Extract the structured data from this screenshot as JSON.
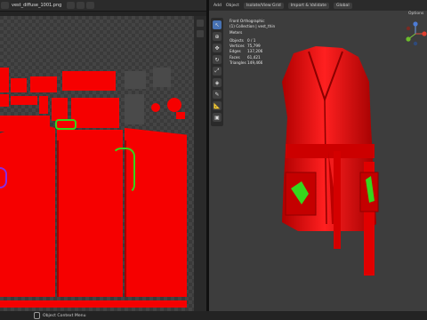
{
  "image_editor": {
    "filename": "vest_diffuse_1001.png"
  },
  "viewport": {
    "menu": [
      "Add",
      "Object"
    ],
    "chips": [
      "Isolate/View Grid",
      "Import & Validate",
      "Global"
    ],
    "options_label": "Options",
    "overlay": {
      "view": "Front Orthographic",
      "collection": "(1) Collection | vest_thin",
      "units": "Meters",
      "stats": [
        {
          "label": "Objects",
          "value": "0 / 1"
        },
        {
          "label": "Vertices",
          "value": "75,799"
        },
        {
          "label": "Edges",
          "value": "137,206"
        },
        {
          "label": "Faces",
          "value": "61,421"
        },
        {
          "label": "Triangles",
          "value": "149,466"
        }
      ]
    }
  },
  "status_bar": {
    "text": "Object Context Menu"
  },
  "colors": {
    "accent": "#f60000",
    "vest_base": "#e00606",
    "uv_highlight": "#36d61c",
    "active_tool": "#4772b3"
  },
  "icons": [
    "select-box-icon",
    "cursor-icon",
    "move-icon",
    "rotate-icon",
    "scale-icon",
    "transform-icon",
    "annotate-icon",
    "measure-icon",
    "add-cube-icon"
  ]
}
